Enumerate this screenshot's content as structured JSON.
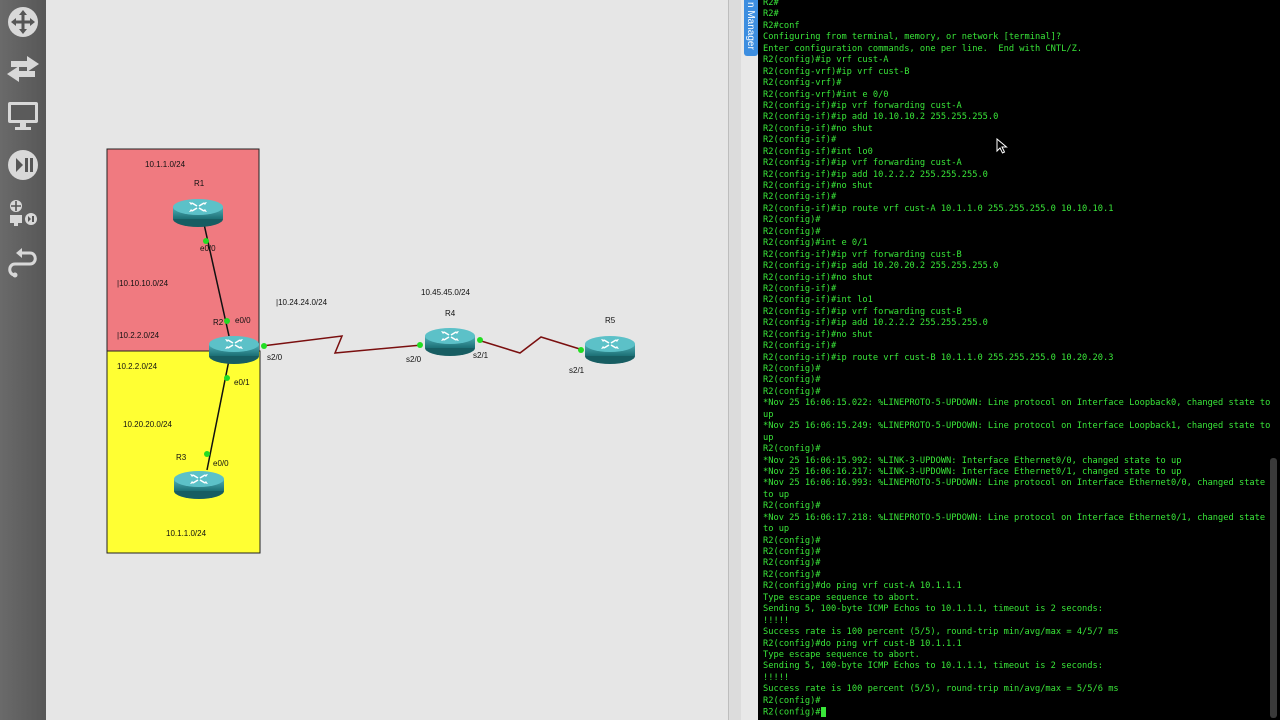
{
  "toolbar": {
    "tools": [
      {
        "name": "move-icon"
      },
      {
        "name": "arrows-icon"
      },
      {
        "name": "monitor-icon"
      },
      {
        "name": "play-pause-icon"
      },
      {
        "name": "device-tools-icon"
      },
      {
        "name": "link-icon"
      }
    ]
  },
  "topology": {
    "areas": [
      {
        "id": "cust-a",
        "color": "#f07a80",
        "labels": [
          "10.1.1.0/24",
          "|10.10.10.0/24",
          "|10.2.2.0/24"
        ]
      },
      {
        "id": "cust-b",
        "color": "#ffff33",
        "labels": [
          "10.2.2.0/24",
          "10.20.20.0/24",
          "10.1.1.0/24"
        ]
      }
    ],
    "routers": [
      "R1",
      "R2",
      "R3",
      "R4",
      "R5"
    ],
    "subnets": {
      "r2_r4": "|10.24.24.0/24",
      "r4_r5": "10.45.45.0/24"
    },
    "interfaces": {
      "r1_e0_0": "e0/0",
      "r2_e0_0": "e0/0",
      "r2_e0_1": "e0/1",
      "r3_e0_0": "e0/0",
      "r2_s2_0": "s2/0",
      "r4_s2_0": "s2/0",
      "r4_s2_1": "s2/1",
      "r5_s2_1": "s2/1"
    },
    "link_color": "#7a0f0f",
    "port_color": "#22dd22"
  },
  "side_tab": {
    "label": "n Manager"
  },
  "terminal": {
    "color": "#39e639",
    "lines": [
      "R2#",
      "R2#",
      "R2#conf",
      "Configuring from terminal, memory, or network [terminal]?",
      "Enter configuration commands, one per line.  End with CNTL/Z.",
      "R2(config)#ip vrf cust-A",
      "R2(config-vrf)#ip vrf cust-B",
      "R2(config-vrf)#",
      "R2(config-vrf)#int e 0/0",
      "R2(config-if)#ip vrf forwarding cust-A",
      "R2(config-if)#ip add 10.10.10.2 255.255.255.0",
      "R2(config-if)#no shut",
      "R2(config-if)#",
      "R2(config-if)#int lo0",
      "R2(config-if)#ip vrf forwarding cust-A",
      "R2(config-if)#ip add 10.2.2.2 255.255.255.0",
      "R2(config-if)#no shut",
      "R2(config-if)#",
      "R2(config-if)#ip route vrf cust-A 10.1.1.0 255.255.255.0 10.10.10.1",
      "R2(config)#",
      "R2(config)#",
      "R2(config)#int e 0/1",
      "R2(config-if)#ip vrf forwarding cust-B",
      "R2(config-if)#ip add 10.20.20.2 255.255.255.0",
      "R2(config-if)#no shut",
      "R2(config-if)#",
      "R2(config-if)#int lo1",
      "R2(config-if)#ip vrf forwarding cust-B",
      "R2(config-if)#ip add 10.2.2.2 255.255.255.0",
      "R2(config-if)#no shut",
      "R2(config-if)#",
      "R2(config-if)#ip route vrf cust-B 10.1.1.0 255.255.255.0 10.20.20.3",
      "R2(config)#",
      "R2(config)#",
      "R2(config)#",
      "*Nov 25 16:06:15.022: %LINEPROTO-5-UPDOWN: Line protocol on Interface Loopback0, changed state to up",
      "*Nov 25 16:06:15.249: %LINEPROTO-5-UPDOWN: Line protocol on Interface Loopback1, changed state to up",
      "R2(config)#",
      "*Nov 25 16:06:15.992: %LINK-3-UPDOWN: Interface Ethernet0/0, changed state to up",
      "*Nov 25 16:06:16.217: %LINK-3-UPDOWN: Interface Ethernet0/1, changed state to up",
      "*Nov 25 16:06:16.993: %LINEPROTO-5-UPDOWN: Line protocol on Interface Ethernet0/0, changed state to up",
      "R2(config)#",
      "*Nov 25 16:06:17.218: %LINEPROTO-5-UPDOWN: Line protocol on Interface Ethernet0/1, changed state to up",
      "R2(config)#",
      "R2(config)#",
      "R2(config)#",
      "R2(config)#",
      "R2(config)#do ping vrf cust-A 10.1.1.1",
      "Type escape sequence to abort.",
      "Sending 5, 100-byte ICMP Echos to 10.1.1.1, timeout is 2 seconds:",
      "!!!!!",
      "Success rate is 100 percent (5/5), round-trip min/avg/max = 4/5/7 ms",
      "R2(config)#do ping vrf cust-B 10.1.1.1",
      "Type escape sequence to abort.",
      "Sending 5, 100-byte ICMP Echos to 10.1.1.1, timeout is 2 seconds:",
      "!!!!!",
      "Success rate is 100 percent (5/5), round-trip min/avg/max = 5/5/6 ms",
      "R2(config)#"
    ],
    "prompt": "R2(config)#"
  }
}
